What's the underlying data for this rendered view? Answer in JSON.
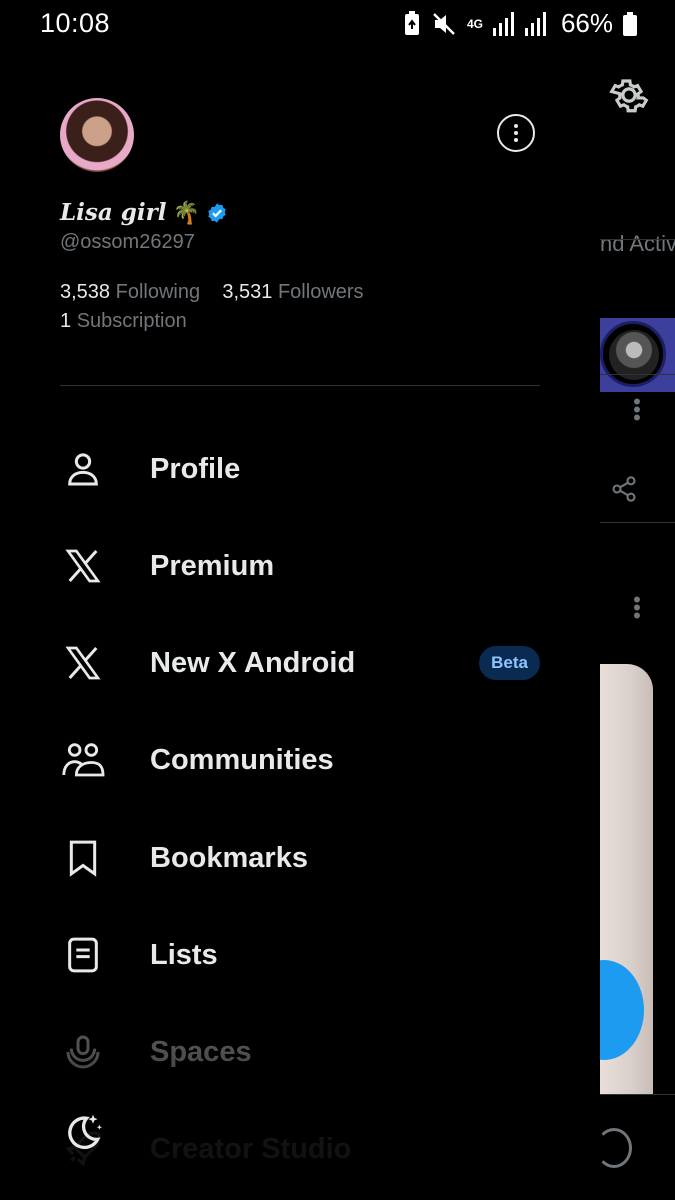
{
  "status_bar": {
    "time": "10:08",
    "network": "4G",
    "battery_percent": "66%"
  },
  "profile": {
    "name": "Lisa girl",
    "emoji": "🌴",
    "handle": "@ossom26297",
    "following_count": "3,538",
    "following_label": "Following",
    "followers_count": "3,531",
    "followers_label": "Followers",
    "subscriptions_count": "1",
    "subscriptions_label": "Subscription"
  },
  "menu": {
    "items": [
      {
        "label": "Profile",
        "icon": "person-icon"
      },
      {
        "label": "Premium",
        "icon": "x-logo-icon"
      },
      {
        "label": "New X Android",
        "icon": "x-logo-icon",
        "badge": "Beta"
      },
      {
        "label": "Communities",
        "icon": "communities-icon"
      },
      {
        "label": "Bookmarks",
        "icon": "bookmark-icon"
      },
      {
        "label": "Lists",
        "icon": "list-icon"
      },
      {
        "label": "Spaces",
        "icon": "spaces-icon"
      },
      {
        "label": "Creator Studio",
        "icon": "rocket-icon"
      }
    ]
  },
  "background": {
    "tab_fragment": "nd Activ"
  },
  "colors": {
    "background": "#000000",
    "text": "#e7e9ea",
    "muted": "#71767b",
    "accent": "#1d9bf0",
    "badge_bg": "#0a2a52"
  }
}
